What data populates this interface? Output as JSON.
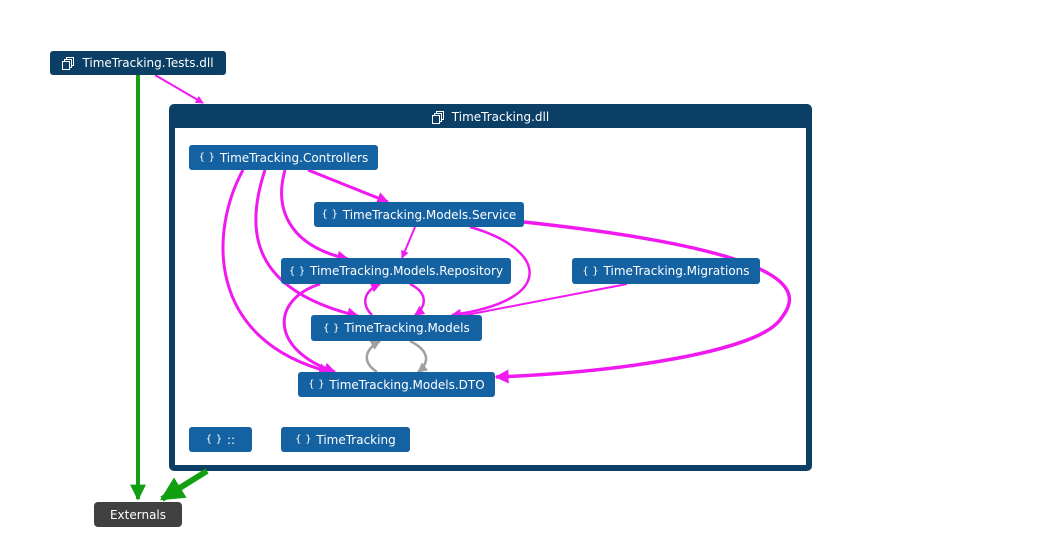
{
  "tests_dll": {
    "label": "TimeTracking.Tests.dll",
    "icon": "assembly-icon"
  },
  "main_dll": {
    "label": "TimeTracking.dll",
    "icon": "assembly-icon"
  },
  "externals": {
    "label": "Externals"
  },
  "namespaces": {
    "controllers": "TimeTracking.Controllers",
    "service": "TimeTracking.Models.Service",
    "repository": "TimeTracking.Models.Repository",
    "migrations": "TimeTracking.Migrations",
    "models": "TimeTracking.Models",
    "dto": "TimeTracking.Models.DTO",
    "global": "::",
    "root": "TimeTracking"
  },
  "namespace_icon": "{ }",
  "colors": {
    "assembly": "#0b3f66",
    "namespace": "#1562a3",
    "externals": "#404040",
    "edge_namespace": "#f01af0",
    "edge_externals": "#12a012",
    "edge_cycle": "#a0a0a0"
  },
  "edges": [
    {
      "from": "TimeTracking.Tests.dll",
      "to": "TimeTracking.dll",
      "color": "magenta"
    },
    {
      "from": "TimeTracking.Tests.dll",
      "to": "Externals",
      "color": "green"
    },
    {
      "from": "TimeTracking.dll",
      "to": "Externals",
      "color": "green"
    },
    {
      "from": "TimeTracking.Controllers",
      "to": "TimeTracking.Models.Service",
      "color": "magenta"
    },
    {
      "from": "TimeTracking.Controllers",
      "to": "TimeTracking.Models.Repository",
      "color": "magenta"
    },
    {
      "from": "TimeTracking.Controllers",
      "to": "TimeTracking.Models",
      "color": "magenta"
    },
    {
      "from": "TimeTracking.Controllers",
      "to": "TimeTracking.Models.DTO",
      "color": "magenta"
    },
    {
      "from": "TimeTracking.Models.Service",
      "to": "TimeTracking.Models.Repository",
      "color": "magenta"
    },
    {
      "from": "TimeTracking.Models.Service",
      "to": "TimeTracking.Models",
      "color": "magenta"
    },
    {
      "from": "TimeTracking.Models.Service",
      "to": "TimeTracking.Models.DTO",
      "color": "magenta"
    },
    {
      "from": "TimeTracking.Models.Repository",
      "to": "TimeTracking.Models",
      "color": "magenta"
    },
    {
      "from": "TimeTracking.Models.Repository",
      "to": "TimeTracking.Models.DTO",
      "color": "magenta"
    },
    {
      "from": "TimeTracking.Models",
      "to": "TimeTracking.Models.Repository",
      "color": "magenta"
    },
    {
      "from": "TimeTracking.Migrations",
      "to": "TimeTracking.Models",
      "color": "magenta"
    },
    {
      "from": "TimeTracking.Models",
      "to": "TimeTracking.Models.DTO",
      "color": "gray"
    },
    {
      "from": "TimeTracking.Models.DTO",
      "to": "TimeTracking.Models",
      "color": "gray"
    }
  ]
}
